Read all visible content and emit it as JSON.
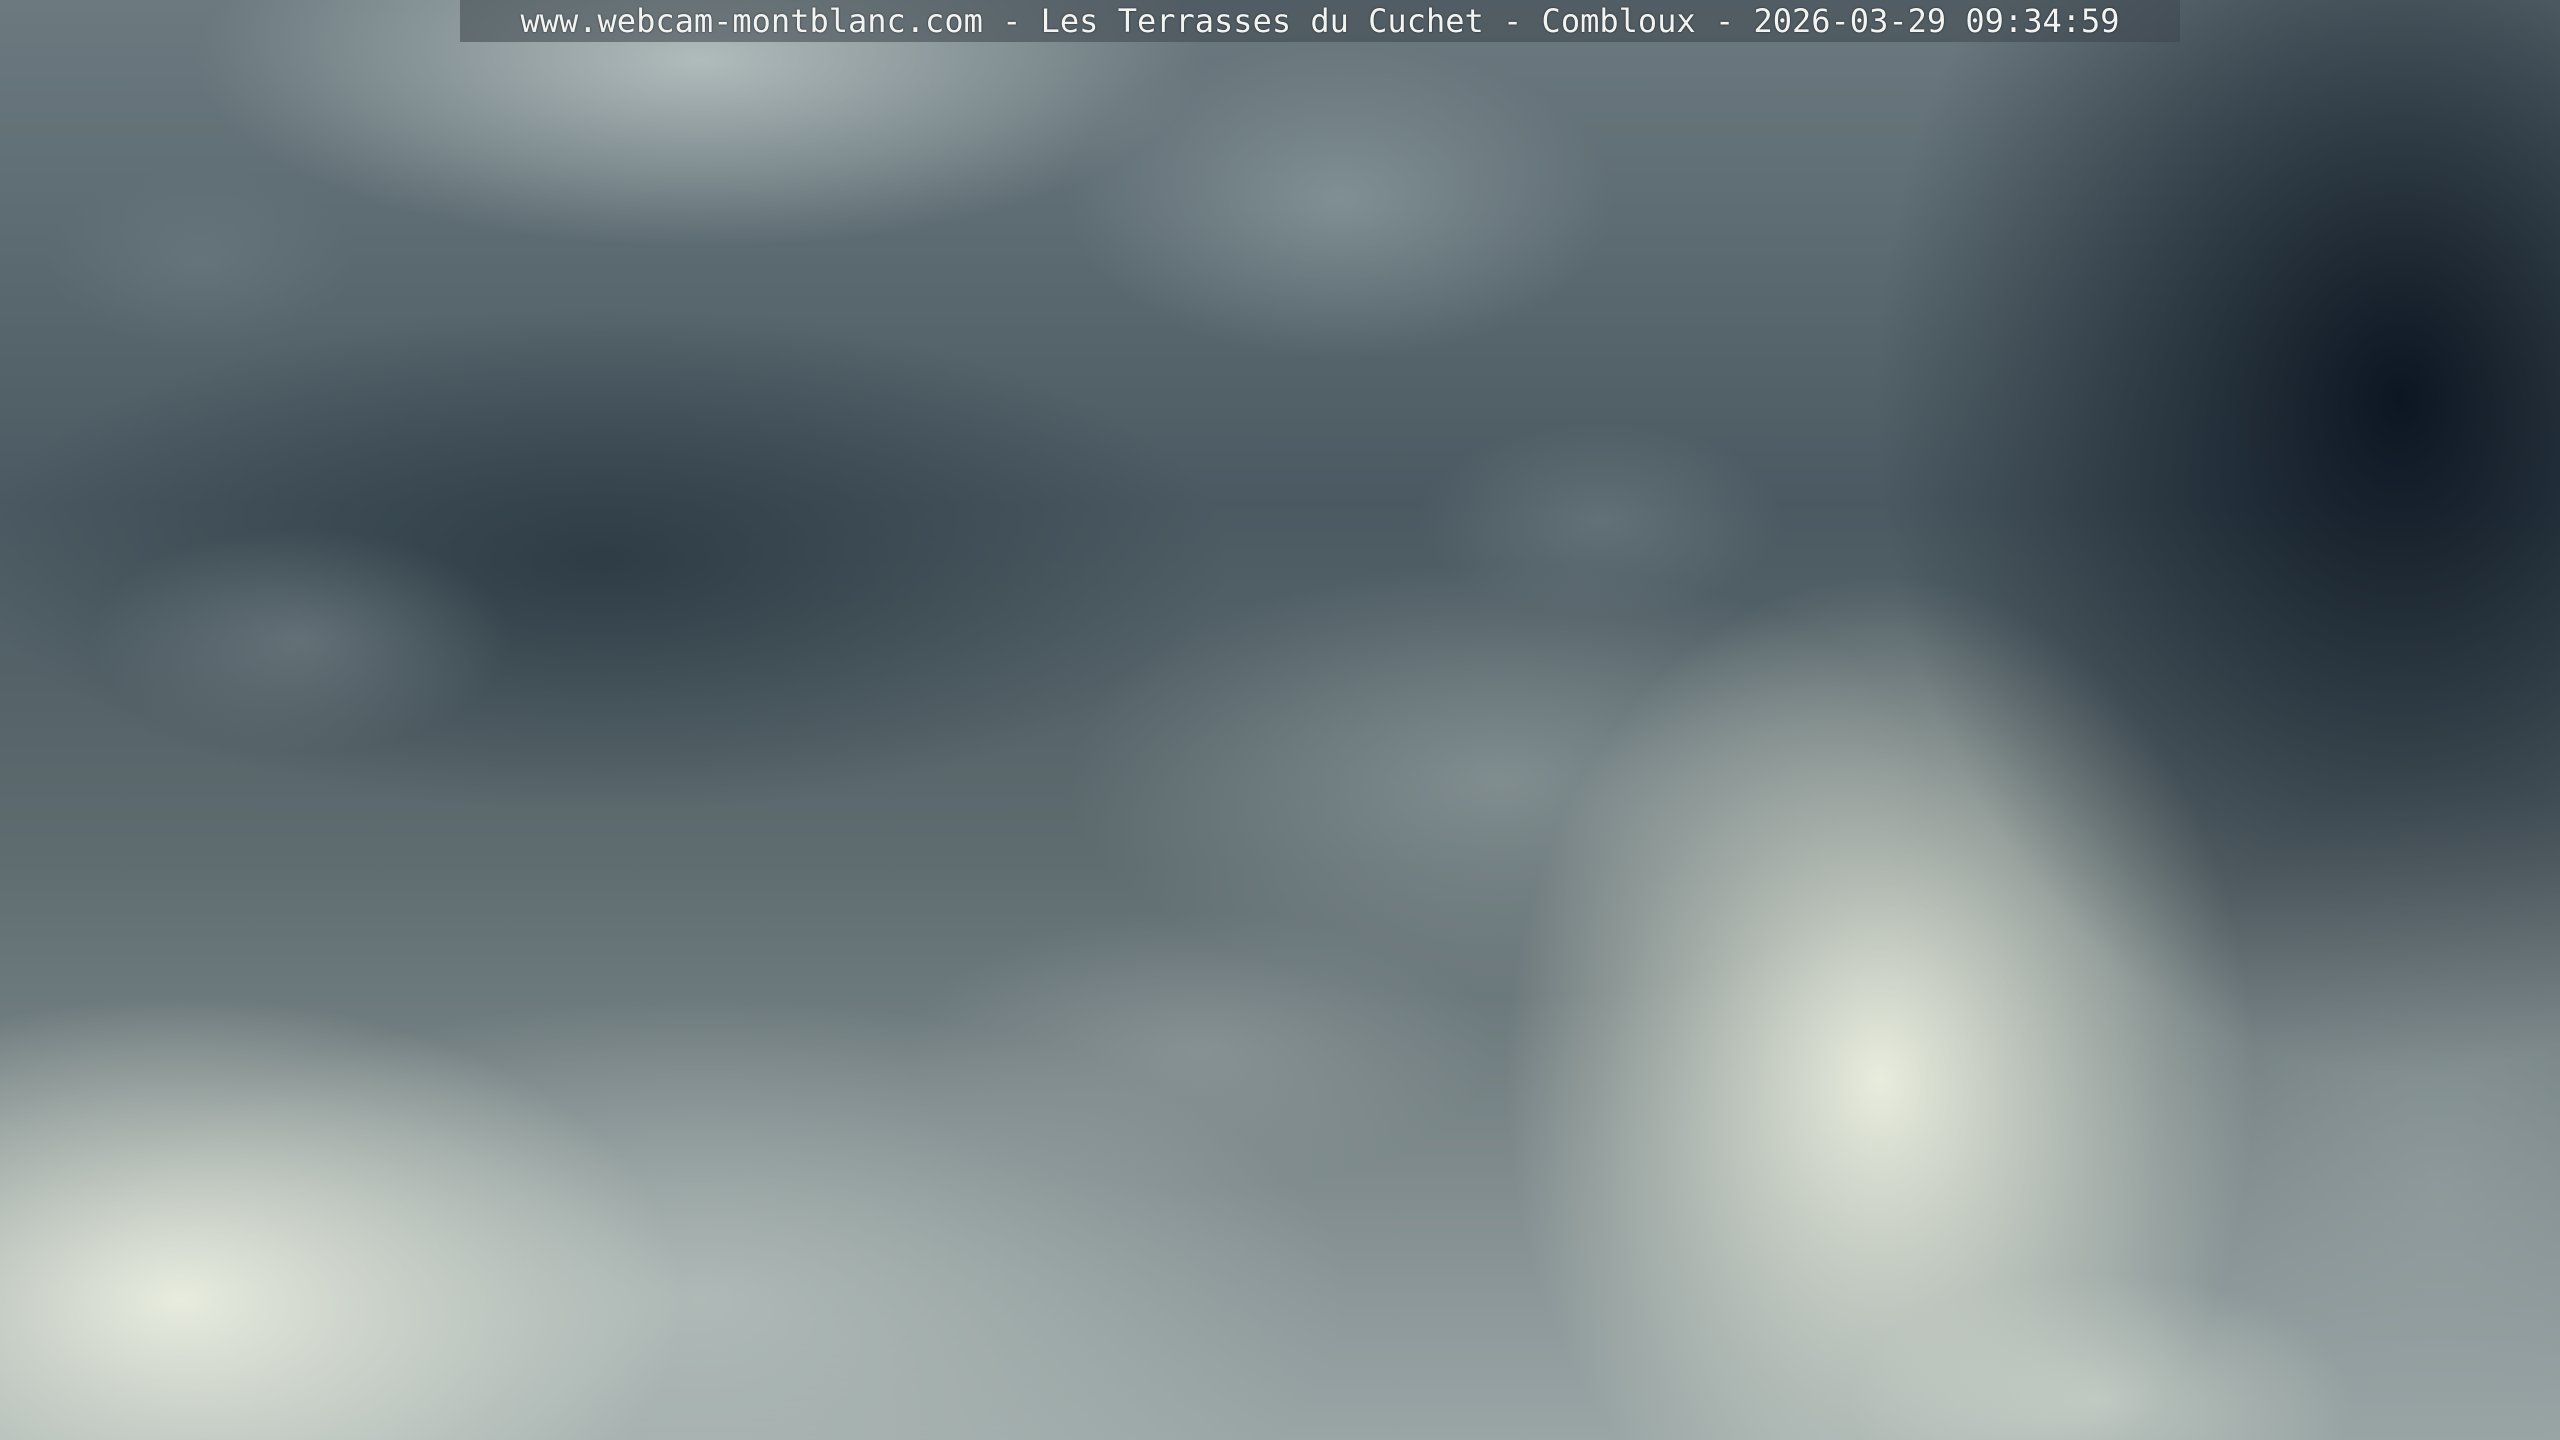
{
  "webcam": {
    "caption": "www.webcam-montblanc.com - Les Terrasses du Cuchet - Combloux - 2026-03-29 09:34:59"
  },
  "colors": {
    "sky_dark": "#0e1a26",
    "cloud_gray": "#5f6c70",
    "cloud_light": "#eef2e2",
    "caption_text": "#f2f4f2"
  }
}
